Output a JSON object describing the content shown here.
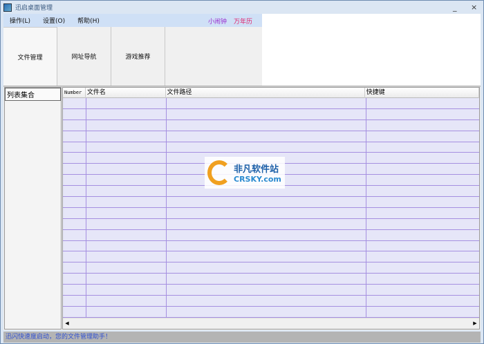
{
  "window": {
    "title": "迅启桌面管理",
    "minimize": "_",
    "close": "×"
  },
  "menu": {
    "items": [
      "操作(L)",
      "设置(O)",
      "帮助(H)"
    ],
    "alarm": "小闹钟",
    "calendar": "万年历",
    "alarm_color": "#9b30d0",
    "calendar_color": "#e0206a"
  },
  "tools": [
    "文件管理",
    "网址导航",
    "游戏推荐"
  ],
  "left_panel": {
    "header": "列表集合"
  },
  "grid": {
    "columns": [
      "Number",
      "文件名",
      "文件路径",
      "快捷键"
    ],
    "rows": []
  },
  "watermark": {
    "line1": "非凡软件站",
    "line2": "CRSKY.com"
  },
  "status": "迅闪快速度启动，您的文件管理助手！"
}
